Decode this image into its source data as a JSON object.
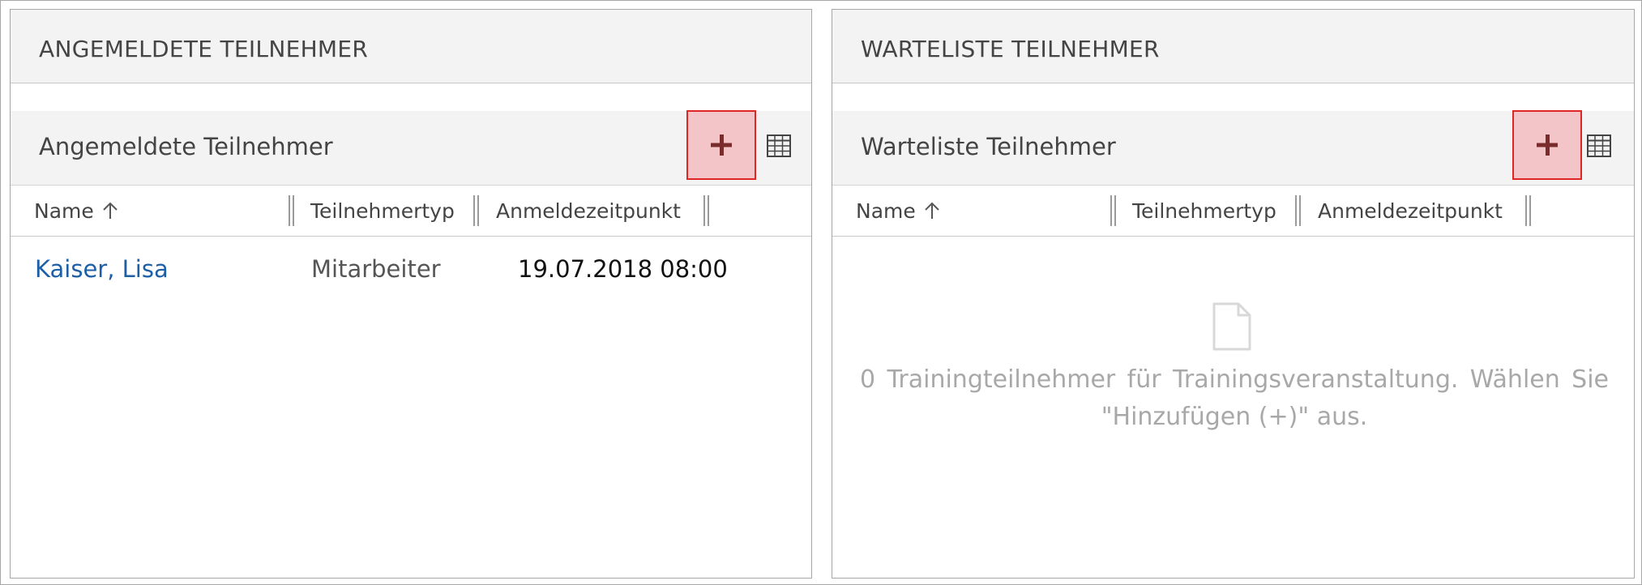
{
  "left_panel": {
    "section_title": "ANGEMELDETE TEILNEHMER",
    "subgrid_title": "Angemeldete Teilnehmer",
    "add_icon": "plus-icon",
    "view_icon": "grid-icon",
    "columns": [
      {
        "label": "Name",
        "sort": "ascending"
      },
      {
        "label": "Teilnehmertyp"
      },
      {
        "label": "Anmeldezeitpunkt"
      }
    ],
    "rows": [
      {
        "name": "Kaiser, Lisa",
        "type": "Mitarbeiter",
        "timestamp": "19.07.2018 08:00"
      }
    ]
  },
  "right_panel": {
    "section_title": "WARTELISTE TEILNEHMER",
    "subgrid_title": "Warteliste Teilnehmer",
    "add_icon": "plus-icon",
    "view_icon": "grid-icon",
    "columns": [
      {
        "label": "Name",
        "sort": "ascending"
      },
      {
        "label": "Teilnehmertyp"
      },
      {
        "label": "Anmeldezeitpunkt"
      }
    ],
    "empty_icon": "document-icon",
    "empty_message_line1": "0 Trainingteilnehmer für Trainingsveranstaltung. Wählen Sie",
    "empty_message_line2": "\"Hinzufügen (+)\" aus."
  },
  "colors": {
    "highlight_fill": "#f4c5c8",
    "highlight_border": "#e02525",
    "link": "#1d5fa6",
    "header_bg": "#f3f3f3"
  }
}
